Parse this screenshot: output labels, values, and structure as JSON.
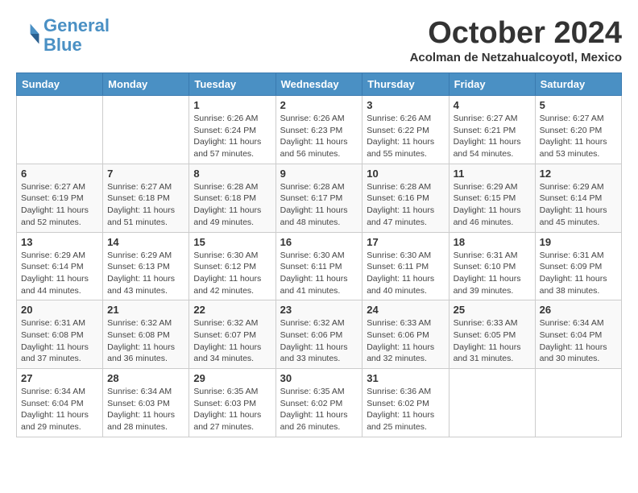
{
  "logo": {
    "line1": "General",
    "line2": "Blue"
  },
  "title": "October 2024",
  "location": "Acolman de Netzahualcoyotl, Mexico",
  "weekdays": [
    "Sunday",
    "Monday",
    "Tuesday",
    "Wednesday",
    "Thursday",
    "Friday",
    "Saturday"
  ],
  "weeks": [
    [
      {
        "day": "",
        "info": ""
      },
      {
        "day": "",
        "info": ""
      },
      {
        "day": "1",
        "info": "Sunrise: 6:26 AM\nSunset: 6:24 PM\nDaylight: 11 hours and 57 minutes."
      },
      {
        "day": "2",
        "info": "Sunrise: 6:26 AM\nSunset: 6:23 PM\nDaylight: 11 hours and 56 minutes."
      },
      {
        "day": "3",
        "info": "Sunrise: 6:26 AM\nSunset: 6:22 PM\nDaylight: 11 hours and 55 minutes."
      },
      {
        "day": "4",
        "info": "Sunrise: 6:27 AM\nSunset: 6:21 PM\nDaylight: 11 hours and 54 minutes."
      },
      {
        "day": "5",
        "info": "Sunrise: 6:27 AM\nSunset: 6:20 PM\nDaylight: 11 hours and 53 minutes."
      }
    ],
    [
      {
        "day": "6",
        "info": "Sunrise: 6:27 AM\nSunset: 6:19 PM\nDaylight: 11 hours and 52 minutes."
      },
      {
        "day": "7",
        "info": "Sunrise: 6:27 AM\nSunset: 6:18 PM\nDaylight: 11 hours and 51 minutes."
      },
      {
        "day": "8",
        "info": "Sunrise: 6:28 AM\nSunset: 6:18 PM\nDaylight: 11 hours and 49 minutes."
      },
      {
        "day": "9",
        "info": "Sunrise: 6:28 AM\nSunset: 6:17 PM\nDaylight: 11 hours and 48 minutes."
      },
      {
        "day": "10",
        "info": "Sunrise: 6:28 AM\nSunset: 6:16 PM\nDaylight: 11 hours and 47 minutes."
      },
      {
        "day": "11",
        "info": "Sunrise: 6:29 AM\nSunset: 6:15 PM\nDaylight: 11 hours and 46 minutes."
      },
      {
        "day": "12",
        "info": "Sunrise: 6:29 AM\nSunset: 6:14 PM\nDaylight: 11 hours and 45 minutes."
      }
    ],
    [
      {
        "day": "13",
        "info": "Sunrise: 6:29 AM\nSunset: 6:14 PM\nDaylight: 11 hours and 44 minutes."
      },
      {
        "day": "14",
        "info": "Sunrise: 6:29 AM\nSunset: 6:13 PM\nDaylight: 11 hours and 43 minutes."
      },
      {
        "day": "15",
        "info": "Sunrise: 6:30 AM\nSunset: 6:12 PM\nDaylight: 11 hours and 42 minutes."
      },
      {
        "day": "16",
        "info": "Sunrise: 6:30 AM\nSunset: 6:11 PM\nDaylight: 11 hours and 41 minutes."
      },
      {
        "day": "17",
        "info": "Sunrise: 6:30 AM\nSunset: 6:11 PM\nDaylight: 11 hours and 40 minutes."
      },
      {
        "day": "18",
        "info": "Sunrise: 6:31 AM\nSunset: 6:10 PM\nDaylight: 11 hours and 39 minutes."
      },
      {
        "day": "19",
        "info": "Sunrise: 6:31 AM\nSunset: 6:09 PM\nDaylight: 11 hours and 38 minutes."
      }
    ],
    [
      {
        "day": "20",
        "info": "Sunrise: 6:31 AM\nSunset: 6:08 PM\nDaylight: 11 hours and 37 minutes."
      },
      {
        "day": "21",
        "info": "Sunrise: 6:32 AM\nSunset: 6:08 PM\nDaylight: 11 hours and 36 minutes."
      },
      {
        "day": "22",
        "info": "Sunrise: 6:32 AM\nSunset: 6:07 PM\nDaylight: 11 hours and 34 minutes."
      },
      {
        "day": "23",
        "info": "Sunrise: 6:32 AM\nSunset: 6:06 PM\nDaylight: 11 hours and 33 minutes."
      },
      {
        "day": "24",
        "info": "Sunrise: 6:33 AM\nSunset: 6:06 PM\nDaylight: 11 hours and 32 minutes."
      },
      {
        "day": "25",
        "info": "Sunrise: 6:33 AM\nSunset: 6:05 PM\nDaylight: 11 hours and 31 minutes."
      },
      {
        "day": "26",
        "info": "Sunrise: 6:34 AM\nSunset: 6:04 PM\nDaylight: 11 hours and 30 minutes."
      }
    ],
    [
      {
        "day": "27",
        "info": "Sunrise: 6:34 AM\nSunset: 6:04 PM\nDaylight: 11 hours and 29 minutes."
      },
      {
        "day": "28",
        "info": "Sunrise: 6:34 AM\nSunset: 6:03 PM\nDaylight: 11 hours and 28 minutes."
      },
      {
        "day": "29",
        "info": "Sunrise: 6:35 AM\nSunset: 6:03 PM\nDaylight: 11 hours and 27 minutes."
      },
      {
        "day": "30",
        "info": "Sunrise: 6:35 AM\nSunset: 6:02 PM\nDaylight: 11 hours and 26 minutes."
      },
      {
        "day": "31",
        "info": "Sunrise: 6:36 AM\nSunset: 6:02 PM\nDaylight: 11 hours and 25 minutes."
      },
      {
        "day": "",
        "info": ""
      },
      {
        "day": "",
        "info": ""
      }
    ]
  ]
}
